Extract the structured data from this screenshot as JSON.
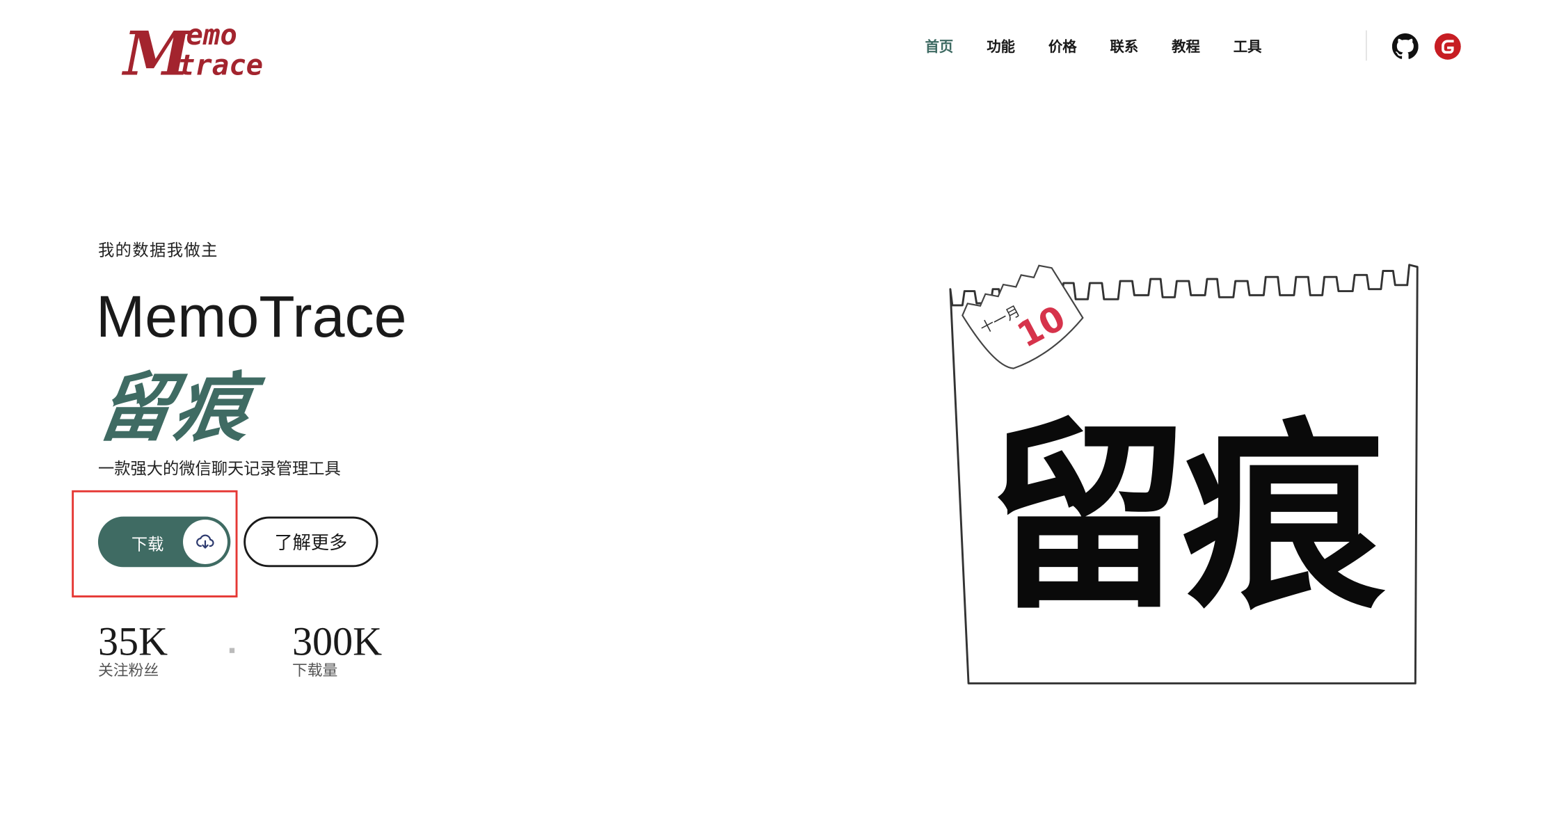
{
  "logo": {
    "line1": "emo",
    "line2": "trace",
    "initial": "M"
  },
  "nav": {
    "items": [
      {
        "label": "首页",
        "active": true
      },
      {
        "label": "功能",
        "active": false
      },
      {
        "label": "价格",
        "active": false
      },
      {
        "label": "联系",
        "active": false
      },
      {
        "label": "教程",
        "active": false
      },
      {
        "label": "工具",
        "active": false
      }
    ],
    "icons": [
      "github-icon",
      "gitee-icon"
    ]
  },
  "hero": {
    "tagline": "我的数据我做主",
    "title_en": "MemoTrace",
    "title_cn": "留痕",
    "subtitle": "一款强大的微信聊天记录管理工具",
    "download_label": "下载",
    "download_icon": "cloud-download-icon",
    "more_label": "了解更多"
  },
  "stats": [
    {
      "value": "35K",
      "label": "关注粉丝"
    },
    {
      "value": "300K",
      "label": "下载量"
    }
  ],
  "illustration": {
    "calendar_month": "十一月",
    "calendar_day": "10",
    "big_text": "留痕"
  },
  "colors": {
    "brand_green": "#3f6b63",
    "logo_red": "#a3242e",
    "highlight_red": "#e53935",
    "gitee_red": "#c71d23"
  }
}
